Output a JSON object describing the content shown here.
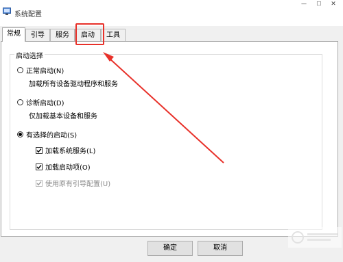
{
  "window": {
    "title": "系统配置",
    "controls": {
      "minimize": "—",
      "maximize": "☐",
      "close": "✕"
    }
  },
  "tabs": [
    {
      "label": "常规",
      "active": true
    },
    {
      "label": "引导",
      "active": false
    },
    {
      "label": "服务",
      "active": false
    },
    {
      "label": "启动",
      "active": false,
      "highlighted": true
    },
    {
      "label": "工具",
      "active": false
    }
  ],
  "startup_group": {
    "legend": "启动选择",
    "options": [
      {
        "label": "正常启动(N)",
        "underline": "N",
        "description": "加载所有设备驱动程序和服务",
        "selected": false
      },
      {
        "label": "诊断启动(D)",
        "underline": "D",
        "description": "仅加载基本设备和服务",
        "selected": false
      },
      {
        "label": "有选择的启动(S)",
        "underline": "S",
        "selected": true
      }
    ],
    "checkboxes": [
      {
        "label": "加载系统服务(L)",
        "checked": true,
        "enabled": true
      },
      {
        "label": "加载启动项(O)",
        "checked": true,
        "enabled": true
      },
      {
        "label": "使用原有引导配置(U)",
        "checked": true,
        "enabled": false
      }
    ]
  },
  "buttons": {
    "ok": "确定",
    "cancel": "取消"
  },
  "annotation": {
    "color": "#e8312a"
  },
  "colors": {
    "title_bar": "#ffffff",
    "window_bg": "#f0f0f0",
    "panel_bg": "#ffffff"
  }
}
